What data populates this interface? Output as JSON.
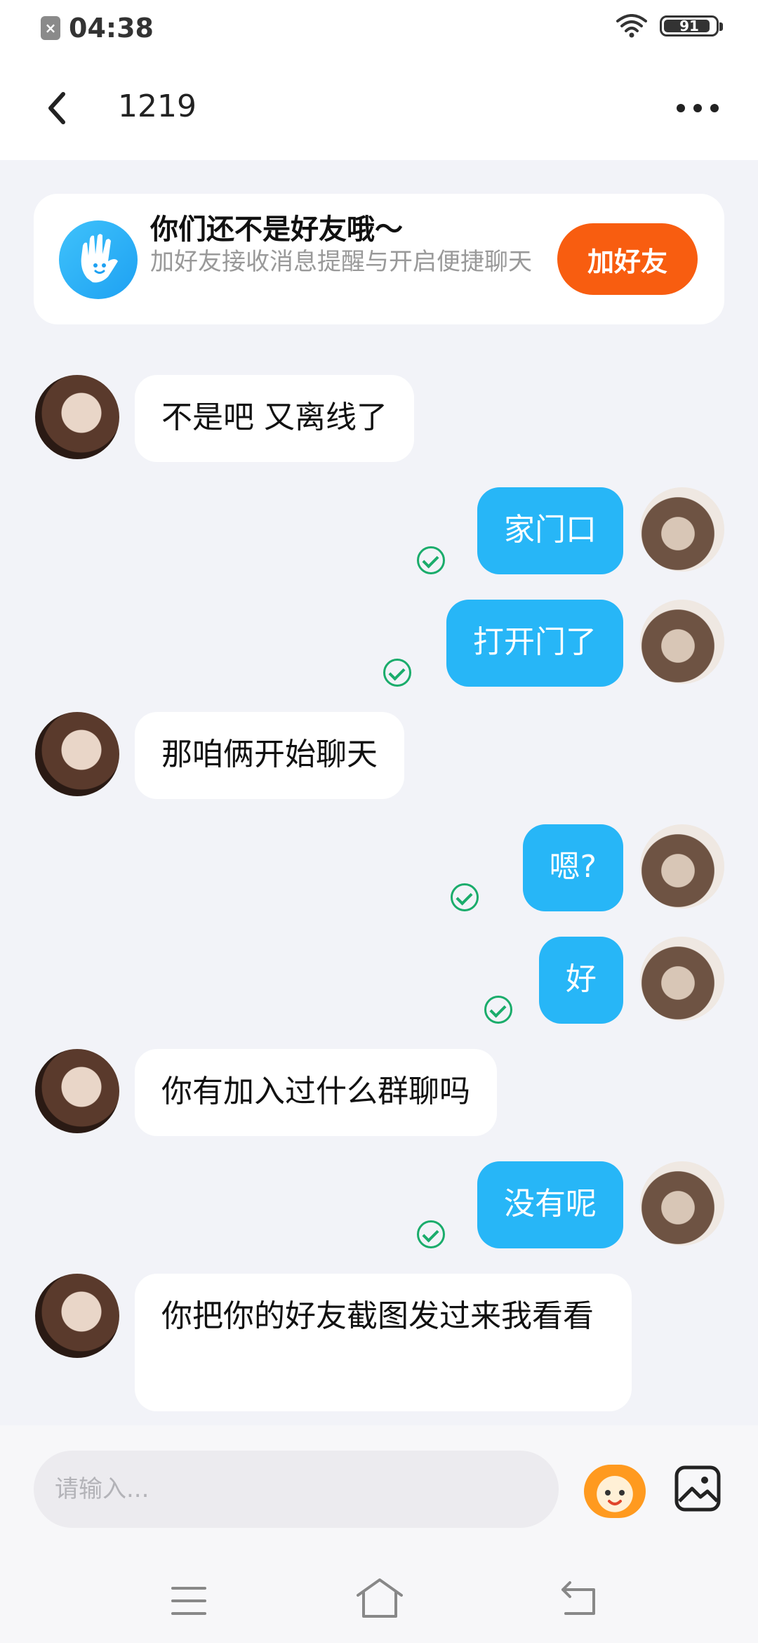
{
  "status_bar": {
    "time": "04:38",
    "battery": "91"
  },
  "header": {
    "title": "1219"
  },
  "friend_card": {
    "title": "你们还不是好友哦～",
    "desc": "加好友接收消息提醒与开启便捷聊天",
    "button": "加好友"
  },
  "messages": [
    {
      "from": "them",
      "text": "不是吧 又离线了"
    },
    {
      "from": "me",
      "text": "家门口",
      "read": true
    },
    {
      "from": "me",
      "text": "打开门了",
      "read": true
    },
    {
      "from": "them",
      "text": "那咱俩开始聊天"
    },
    {
      "from": "me",
      "text": "嗯?",
      "read": true
    },
    {
      "from": "me",
      "text": "好",
      "read": true
    },
    {
      "from": "them",
      "text": "你有加入过什么群聊吗"
    },
    {
      "from": "me",
      "text": "没有呢",
      "read": true
    },
    {
      "from": "them",
      "text": "你把你的好友截图发过来我看看"
    }
  ],
  "input": {
    "placeholder": "请输入..."
  },
  "colors": {
    "accent_blue": "#27b6f7",
    "button_orange": "#f85d10",
    "read_green": "#1aac6b",
    "background": "#f2f3f8"
  },
  "icons": [
    "back-arrow-icon",
    "more-icon",
    "hand-icon",
    "sticker-icon",
    "image-icon",
    "menu-icon",
    "home-icon",
    "back-nav-icon"
  ]
}
